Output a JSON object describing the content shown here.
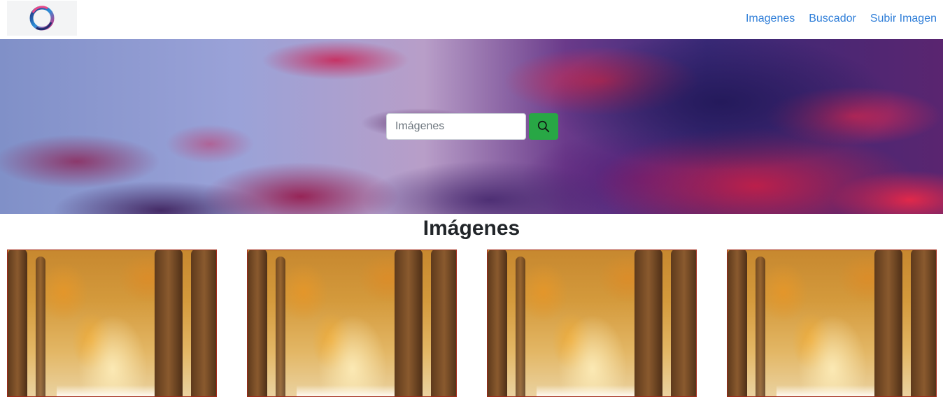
{
  "navbar": {
    "logo_icon": "circle-logo-icon",
    "links": [
      {
        "label": "Imagenes"
      },
      {
        "label": "Buscador"
      },
      {
        "label": "Subir Imagen"
      }
    ]
  },
  "hero": {
    "search": {
      "placeholder": "Imágenes",
      "value": ""
    },
    "search_icon": "search-icon",
    "button_color": "#28a745"
  },
  "gallery": {
    "title": "Imágenes",
    "cards": [
      {
        "image": "autumn-forest-image"
      },
      {
        "image": "autumn-forest-image"
      },
      {
        "image": "autumn-forest-image"
      },
      {
        "image": "autumn-forest-image"
      }
    ]
  },
  "colors": {
    "link": "#2f7ed8",
    "card_border": "#a22a1a"
  }
}
